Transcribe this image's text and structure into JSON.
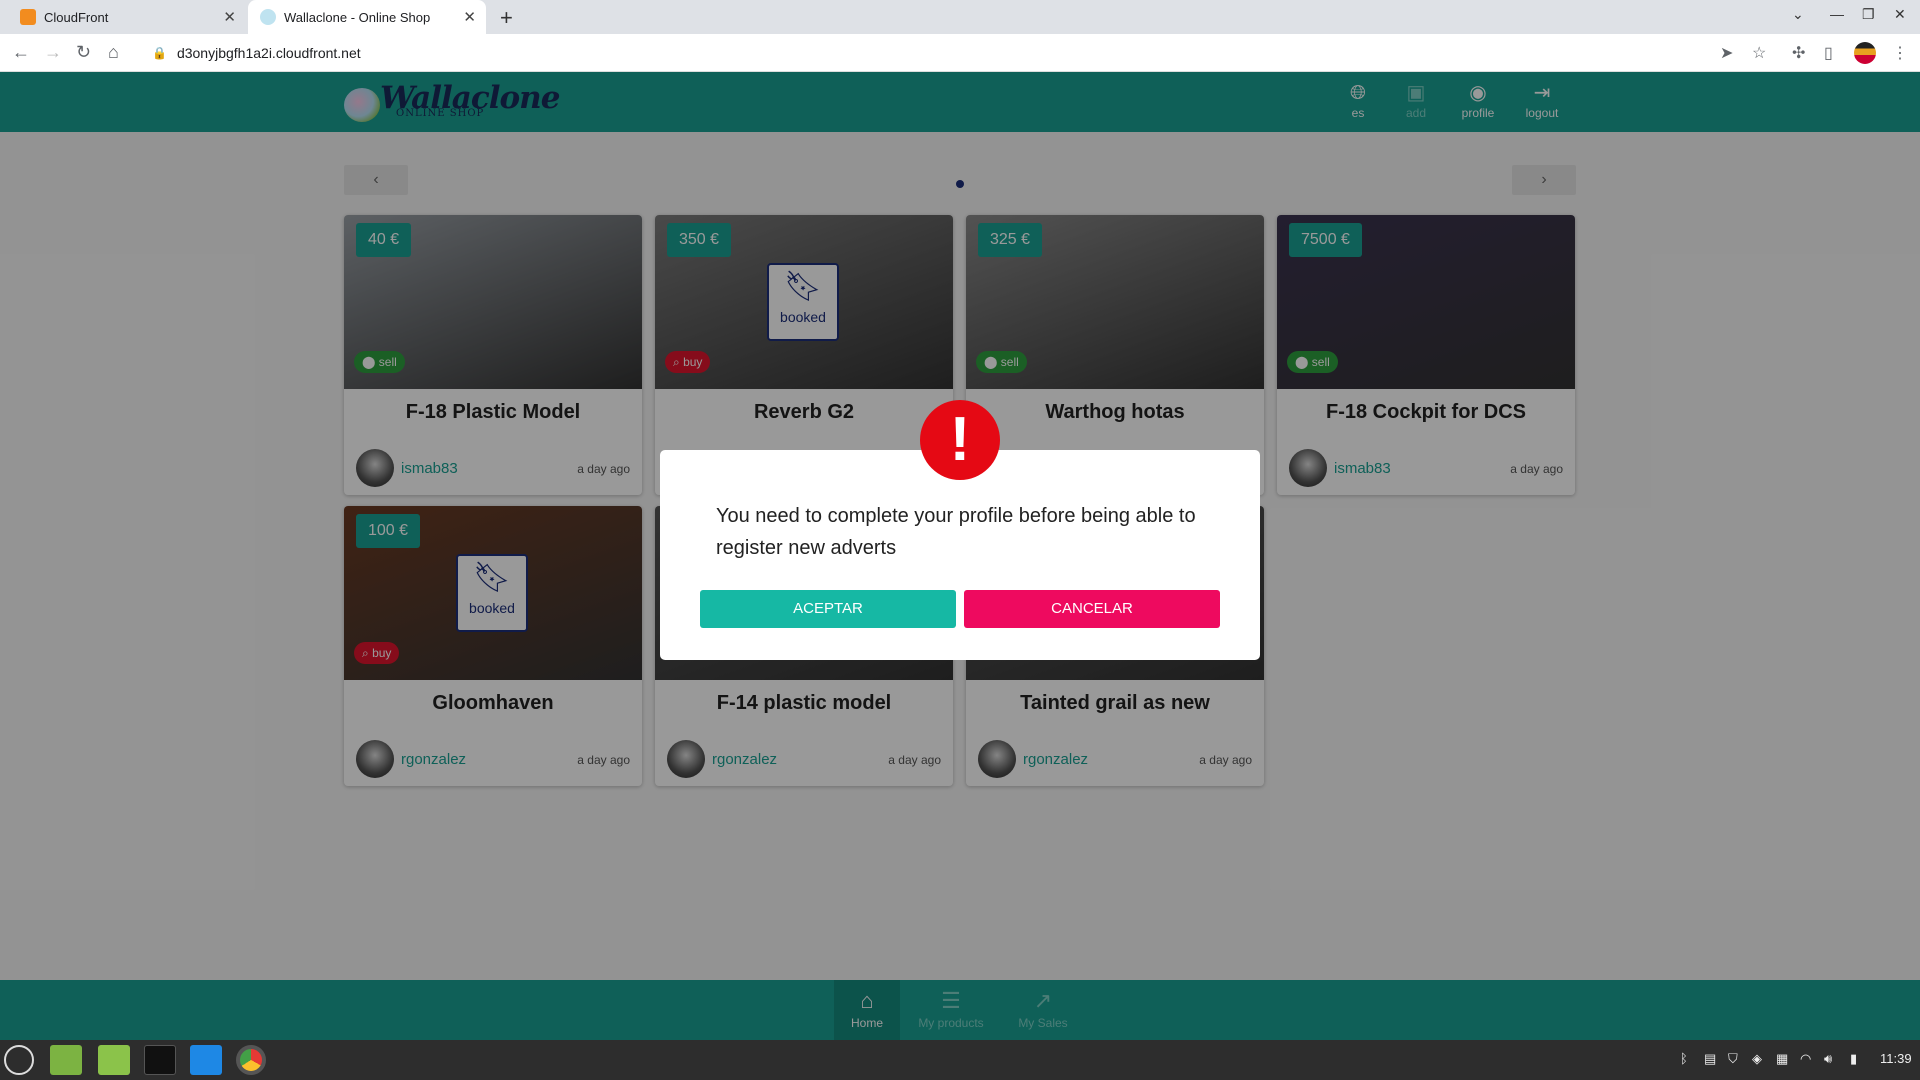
{
  "browser": {
    "tabs": [
      {
        "title": "CloudFront",
        "active": false
      },
      {
        "title": "Wallaclone - Online Shop",
        "active": true
      }
    ],
    "url": "d3onyjbgfh1a2i.cloudfront.net"
  },
  "header": {
    "logo_main": "Wallaclone",
    "logo_sub": "ONLINE SHOP",
    "nav": [
      {
        "label": "es",
        "icon": "globe-icon"
      },
      {
        "label": "add",
        "icon": "add-image-icon"
      },
      {
        "label": "profile",
        "icon": "user-icon"
      },
      {
        "label": "logout",
        "icon": "logout-icon"
      }
    ]
  },
  "carousel": {
    "prev": "‹",
    "next": "›"
  },
  "adverts": [
    {
      "title": "F-18 Plastic Model",
      "price": "40 €",
      "type": "sell",
      "booked": false,
      "user": "ismab83",
      "date": "a day ago",
      "color": "#9aa0a6"
    },
    {
      "title": "Reverb G2",
      "price": "350 €",
      "type": "buy",
      "booked": true,
      "user": "",
      "date": "",
      "color": "#7c7c7c"
    },
    {
      "title": "Warthog hotas",
      "price": "325 €",
      "type": "sell",
      "booked": false,
      "user": "",
      "date": "",
      "color": "#8a8a8a"
    },
    {
      "title": "F-18 Cockpit for DCS",
      "price": "7500 €",
      "type": "sell",
      "booked": false,
      "user": "ismab83",
      "date": "a day ago",
      "color": "#3b3350"
    },
    {
      "title": "Gloomhaven",
      "price": "100 €",
      "type": "buy",
      "booked": true,
      "user": "rgonzalez",
      "date": "a day ago",
      "color": "#6b3a22"
    },
    {
      "title": "F-14 plastic model",
      "price": "",
      "type": "",
      "booked": false,
      "user": "rgonzalez",
      "date": "a day ago",
      "color": "#555"
    },
    {
      "title": "Tainted grail as new",
      "price": "",
      "type": "",
      "booked": false,
      "user": "rgonzalez",
      "date": "a day ago",
      "color": "#555"
    }
  ],
  "booked_label": "booked",
  "bottom_nav": [
    {
      "label": "Home",
      "active": true
    },
    {
      "label": "My products",
      "active": false
    },
    {
      "label": "My Sales",
      "active": false
    }
  ],
  "dialog": {
    "message": "You need to complete your profile before being able to register new adverts",
    "accept": "ACEPTAR",
    "cancel": "CANCELAR"
  },
  "taskbar": {
    "time": "11:39"
  }
}
